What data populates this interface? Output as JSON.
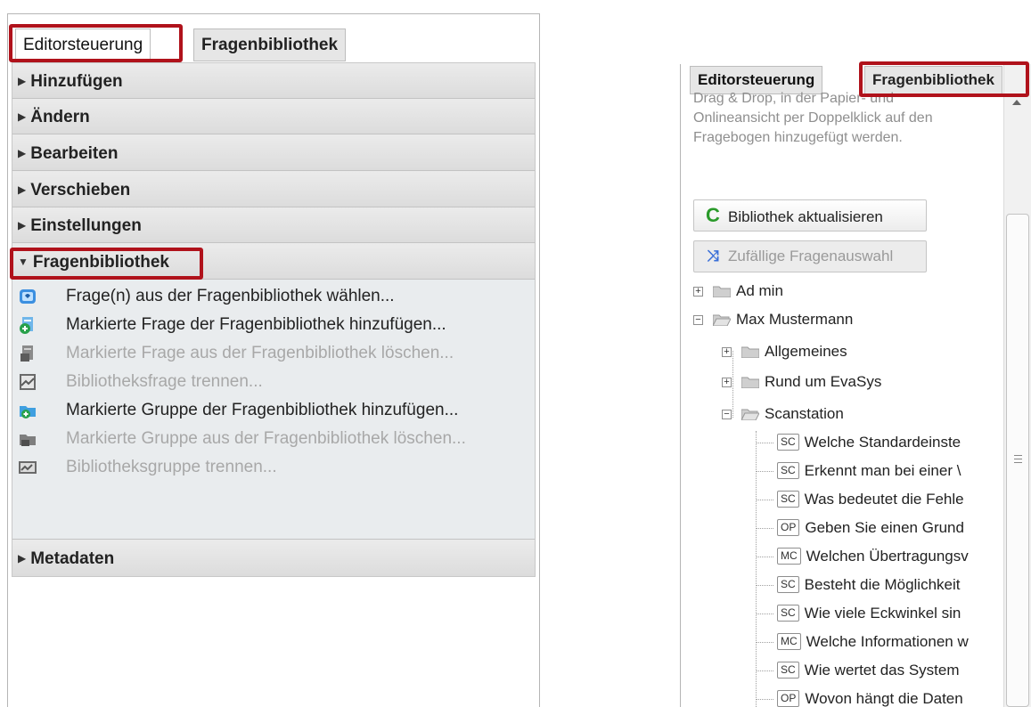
{
  "left_panel": {
    "tabs": {
      "editor": "Editorsteuerung",
      "library": "Fragenbibliothek"
    },
    "sections": {
      "add": "Hinzufügen",
      "change": "Ändern",
      "edit": "Bearbeiten",
      "move": "Verschieben",
      "settings": "Einstellungen",
      "library": "Fragenbibliothek",
      "metadata": "Metadaten"
    },
    "library_items": [
      {
        "label": "Frage(n) aus der Fragenbibliothek wählen...",
        "icon": "library-select-icon",
        "enabled": true
      },
      {
        "label": "Markierte Frage der Fragenbibliothek hinzufügen...",
        "icon": "add-question-icon",
        "enabled": true
      },
      {
        "label": "Markierte Frage aus der Fragenbibliothek löschen...",
        "icon": "delete-question-icon",
        "enabled": false
      },
      {
        "label": "Bibliotheksfrage trennen...",
        "icon": "unlink-question-icon",
        "enabled": false
      },
      {
        "label": "Markierte Gruppe der Fragenbibliothek hinzufügen...",
        "icon": "add-group-icon",
        "enabled": true
      },
      {
        "label": "Markierte Gruppe aus der Fragenbibliothek löschen...",
        "icon": "delete-group-icon",
        "enabled": false
      },
      {
        "label": "Bibliotheksgruppe trennen...",
        "icon": "unlink-group-icon",
        "enabled": false
      }
    ]
  },
  "right_panel": {
    "tabs": {
      "editor": "Editorsteuerung",
      "library": "Fragenbibliothek"
    },
    "description": "Drag & Drop, in der Papier- und Onlineansicht per Doppelklick auf den Fragebogen hinzugefügt werden.",
    "buttons": {
      "refresh": "Bibliothek aktualisieren",
      "random": "Zufällige Fragenauswahl"
    },
    "tree": {
      "roots": {
        "admin": "Ad min",
        "max": "Max Mustermann"
      },
      "folders": {
        "general": "Allgemeines",
        "evasys": "Rund um EvaSys",
        "scan": "Scanstation"
      },
      "questions": [
        {
          "type": "SC",
          "text": "Welche Standardeinste"
        },
        {
          "type": "SC",
          "text": "Erkennt man bei einer \\"
        },
        {
          "type": "SC",
          "text": "Was bedeutet die Fehle"
        },
        {
          "type": "OP",
          "text": "Geben Sie einen Grund"
        },
        {
          "type": "MC",
          "text": "Welchen Übertragungsv"
        },
        {
          "type": "SC",
          "text": "Besteht die Möglichkeit"
        },
        {
          "type": "SC",
          "text": "Wie viele Eckwinkel sin"
        },
        {
          "type": "MC",
          "text": "Welche Informationen w"
        },
        {
          "type": "SC",
          "text": "Wie wertet das System"
        },
        {
          "type": "OP",
          "text": "Wovon hängt die Daten"
        }
      ]
    }
  },
  "colors": {
    "highlight": "#b0121b",
    "refresh_icon": "#2a9a2a",
    "random_icon": "#3a6fd8"
  }
}
